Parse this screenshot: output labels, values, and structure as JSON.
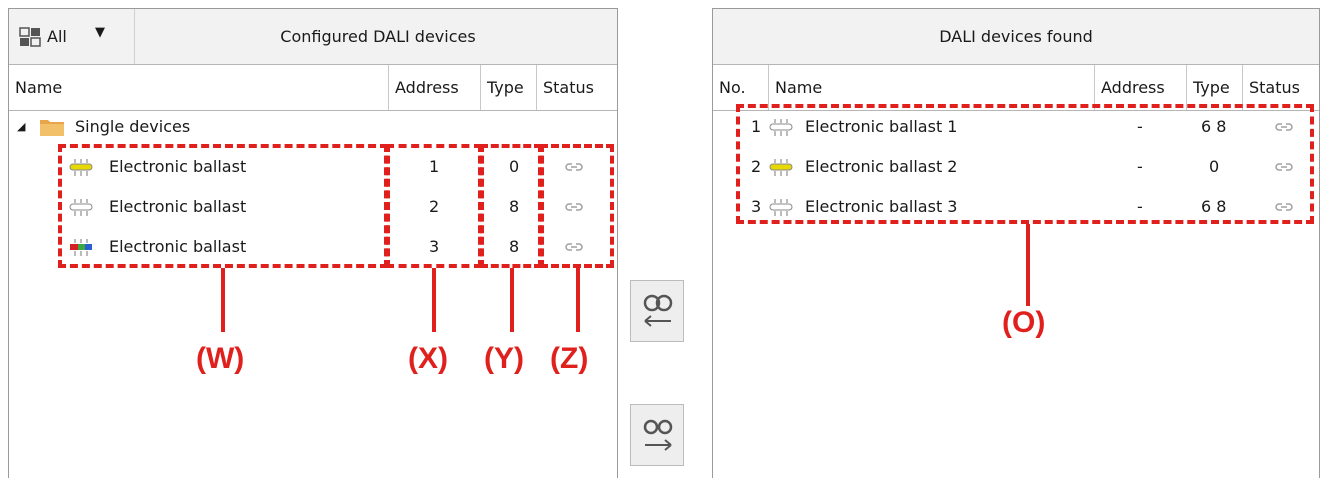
{
  "left_panel": {
    "filter_label": "All",
    "title": "Configured DALI devices",
    "columns": {
      "name": "Name",
      "address": "Address",
      "type": "Type",
      "status": "Status"
    },
    "group": {
      "label": "Single devices"
    },
    "rows": [
      {
        "name": "Electronic ballast",
        "address": "1",
        "type": "0"
      },
      {
        "name": "Electronic ballast",
        "address": "2",
        "type": "8"
      },
      {
        "name": "Electronic ballast",
        "address": "3",
        "type": "8"
      }
    ]
  },
  "right_panel": {
    "title": "DALI devices found",
    "columns": {
      "no": "No.",
      "name": "Name",
      "address": "Address",
      "type": "Type",
      "status": "Status"
    },
    "rows": [
      {
        "no": "1",
        "name": "Electronic ballast 1",
        "address": "-",
        "type": "6 8"
      },
      {
        "no": "2",
        "name": "Electronic ballast 2",
        "address": "-",
        "type": "0"
      },
      {
        "no": "3",
        "name": "Electronic ballast 3",
        "address": "-",
        "type": "6 8"
      }
    ]
  },
  "callouts": {
    "w": "(W)",
    "x": "(X)",
    "y": "(Y)",
    "z": "(Z)",
    "o": "(O)"
  },
  "icons": {
    "filter": "device-filter-icon",
    "caret": "dropdown-caret-icon",
    "expand": "expand-triangle-icon",
    "folder": "folder-icon",
    "bulb_colors": {
      "yellow": "#e6d800",
      "white": "#ffffff",
      "rgb_red": "#d42020",
      "rgb_green": "#3aa845",
      "rgb_blue": "#2a5fd0"
    },
    "status": "link-icon",
    "link_button": "link-assign-icon",
    "unlink_button": "unlink-icon"
  },
  "colors": {
    "annotation": "#e0201c",
    "header_bg": "#f2f2f2",
    "border": "#9a9a9a"
  }
}
